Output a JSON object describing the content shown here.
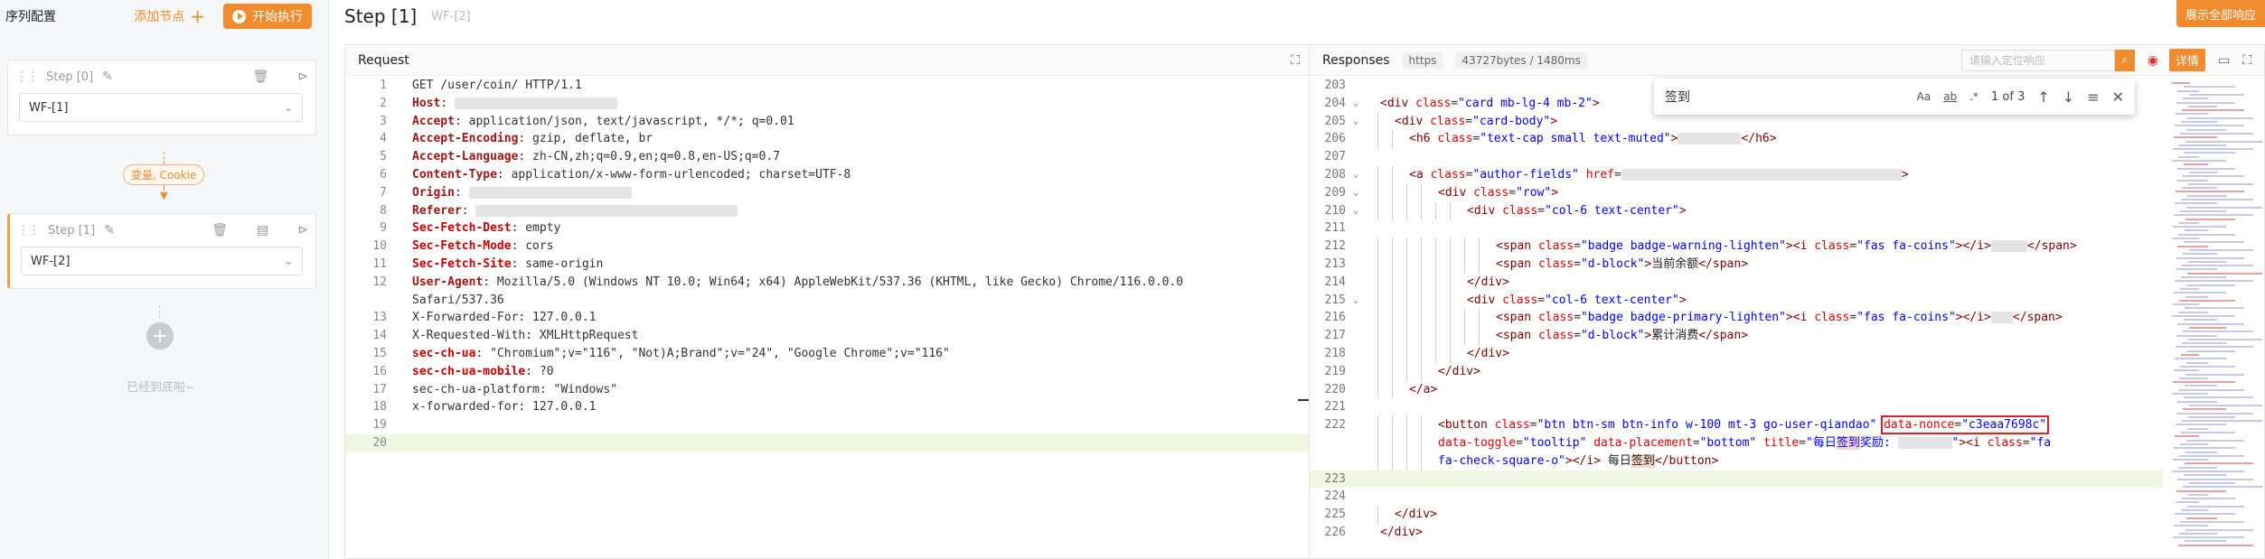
{
  "sidebar": {
    "title": "序列配置",
    "add_node": "添加节点",
    "start": "开始执行",
    "steps": [
      {
        "label": "Step [0]",
        "selected": "WF-[1]"
      },
      {
        "label": "Step [1]",
        "selected": "WF-[2]"
      }
    ],
    "var_pill": "变量, Cookie",
    "bottom_tip": "已经到底啦~"
  },
  "main": {
    "title": "Step [1]",
    "subtitle": "WF-[2]",
    "expand_all": "展示全部响应"
  },
  "request": {
    "title": "Request",
    "lines": [
      {
        "n": "1",
        "key": "",
        "text": "GET /user/coin/ HTTP/1.1",
        "style": "plain"
      },
      {
        "n": "2",
        "key": "Host",
        "text": ": ",
        "style": "key",
        "blur": "m"
      },
      {
        "n": "3",
        "key": "Accept",
        "text": ": application/json, text/javascript, */*; q=0.01",
        "style": "key"
      },
      {
        "n": "4",
        "key": "Accept-Encoding",
        "text": ": gzip, deflate, br",
        "style": "key"
      },
      {
        "n": "5",
        "key": "Accept-Language",
        "text": ": zh-CN,zh;q=0.9,en;q=0.8,en-US;q=0.7",
        "style": "key"
      },
      {
        "n": "6",
        "key": "Content-Type",
        "text": ": application/x-www-form-urlencoded; charset=UTF-8",
        "style": "key"
      },
      {
        "n": "7",
        "key": "Origin",
        "text": ": ",
        "style": "key",
        "blur": "m"
      },
      {
        "n": "8",
        "key": "Referer",
        "text": ": ",
        "style": "key",
        "blur": "l"
      },
      {
        "n": "9",
        "key": "Sec-Fetch-Dest",
        "text": ": empty",
        "style": "key2"
      },
      {
        "n": "10",
        "key": "Sec-Fetch-Mode",
        "text": ": cors",
        "style": "key2"
      },
      {
        "n": "11",
        "key": "Sec-Fetch-Site",
        "text": ": same-origin",
        "style": "key2"
      },
      {
        "n": "12",
        "key": "User-Agent",
        "text": ": Mozilla/5.0 (Windows NT 10.0; Win64; x64) AppleWebKit/537.36 (KHTML, like Gecko) Chrome/116.0.0.0",
        "style": "key"
      },
      {
        "n": "",
        "key": "",
        "text": "Safari/537.36",
        "style": "plain"
      },
      {
        "n": "13",
        "key": "",
        "text": "X-Forwarded-For: 127.0.0.1",
        "style": "plain"
      },
      {
        "n": "14",
        "key": "",
        "text": "X-Requested-With: XMLHttpRequest",
        "style": "plain"
      },
      {
        "n": "15",
        "key": "sec-ch-ua",
        "text": ": \"Chromium\";v=\"116\", \"Not)A;Brand\";v=\"24\", \"Google Chrome\";v=\"116\"",
        "style": "key2"
      },
      {
        "n": "16",
        "key": "sec-ch-ua-mobile",
        "text": ": ?0",
        "style": "key2"
      },
      {
        "n": "17",
        "key": "",
        "text": "sec-ch-ua-platform: \"Windows\"",
        "style": "plain"
      },
      {
        "n": "18",
        "key": "",
        "text": "x-forwarded-for: 127.0.0.1",
        "style": "plain"
      },
      {
        "n": "19",
        "key": "",
        "text": "",
        "style": "plain"
      },
      {
        "n": "20",
        "key": "",
        "text": "",
        "style": "plain",
        "hl": true
      }
    ]
  },
  "responses": {
    "title": "Responses",
    "protocol": "https",
    "size": "43727bytes / 1480ms",
    "search_placeholder": "请输入定位响应",
    "detail": "详情",
    "find": {
      "query": "签到",
      "count": "1 of 3",
      "opt_case": "Aa",
      "opt_word": "ab",
      "opt_regex": ".*"
    }
  },
  "html_lines": [
    {
      "n": "203",
      "indent": 0,
      "fold": false,
      "html": ""
    },
    {
      "n": "204",
      "indent": 0,
      "fold": true,
      "html": "<span class=\"tag\">&lt;div</span> <span class=\"attr\">class</span>=<span class=\"val\">\"card mb-lg-4 mb-2\"</span><span class=\"tag\">&gt;</span>"
    },
    {
      "n": "205",
      "indent": 1,
      "fold": true,
      "html": "<span class=\"tag\">&lt;div</span> <span class=\"attr\">class</span>=<span class=\"val\">\"card-body\"</span><span class=\"tag\">&gt;</span>"
    },
    {
      "n": "206",
      "indent": 2,
      "fold": false,
      "html": "<span class=\"tag\">&lt;h6</span> <span class=\"attr\">class</span>=<span class=\"val\">\"text-cap small text-muted\"</span><span class=\"tag\">&gt;</span><span class=\"blur\" style=\"width:70px\"></span><span class=\"tag\">&lt;/h6&gt;</span>"
    },
    {
      "n": "207",
      "indent": 0,
      "fold": false,
      "html": ""
    },
    {
      "n": "208",
      "indent": 2,
      "fold": true,
      "html": "<span class=\"tag\">&lt;a</span> <span class=\"attr\">class</span>=<span class=\"val\">\"author-fields\"</span> <span class=\"attr\">href</span>=<span class=\"blur xl\"></span><span class=\"tag\">&gt;</span>"
    },
    {
      "n": "209",
      "indent": 4,
      "fold": true,
      "html": "<span class=\"tag\">&lt;div</span> <span class=\"attr\">class</span>=<span class=\"val\">\"row\"</span><span class=\"tag\">&gt;</span>"
    },
    {
      "n": "210",
      "indent": 6,
      "fold": true,
      "html": "<span class=\"tag\">&lt;div</span> <span class=\"attr\">class</span>=<span class=\"val\">\"col-6 text-center\"</span><span class=\"tag\">&gt;</span>"
    },
    {
      "n": "211",
      "indent": 0,
      "fold": false,
      "html": ""
    },
    {
      "n": "212",
      "indent": 8,
      "fold": false,
      "html": "<span class=\"tag\">&lt;span</span> <span class=\"attr\">class</span>=<span class=\"val\">\"badge badge-warning-lighten\"</span><span class=\"tag\">&gt;&lt;i</span> <span class=\"attr\">class</span>=<span class=\"val\">\"fas fa-coins\"</span><span class=\"tag\">&gt;&lt;/i&gt;</span><span class=\"blur s\"></span><span class=\"tag\">&lt;/span&gt;</span>"
    },
    {
      "n": "213",
      "indent": 8,
      "fold": false,
      "html": "<span class=\"tag\">&lt;span</span> <span class=\"attr\">class</span>=<span class=\"val\">\"d-block\"</span><span class=\"tag\">&gt;</span><span class=\"txtc\">当前余额</span><span class=\"tag\">&lt;/span&gt;</span>"
    },
    {
      "n": "214",
      "indent": 6,
      "fold": false,
      "html": "<span class=\"tag\">&lt;/div&gt;</span>"
    },
    {
      "n": "215",
      "indent": 6,
      "fold": true,
      "html": "<span class=\"tag\">&lt;div</span> <span class=\"attr\">class</span>=<span class=\"val\">\"col-6 text-center\"</span><span class=\"tag\">&gt;</span>"
    },
    {
      "n": "216",
      "indent": 8,
      "fold": false,
      "html": "<span class=\"tag\">&lt;span</span> <span class=\"attr\">class</span>=<span class=\"val\">\"badge badge-primary-lighten\"</span><span class=\"tag\">&gt;&lt;i</span> <span class=\"attr\">class</span>=<span class=\"val\">\"fas fa-coins\"</span><span class=\"tag\">&gt;&lt;/i&gt;</span><span class=\"blur\" style=\"width:24px\"></span><span class=\"tag\">&lt;/span&gt;</span>"
    },
    {
      "n": "217",
      "indent": 8,
      "fold": false,
      "html": "<span class=\"tag\">&lt;span</span> <span class=\"attr\">class</span>=<span class=\"val\">\"d-block\"</span><span class=\"tag\">&gt;</span><span class=\"txtc\">累计消费</span><span class=\"tag\">&lt;/span&gt;</span>"
    },
    {
      "n": "218",
      "indent": 6,
      "fold": false,
      "html": "<span class=\"tag\">&lt;/div&gt;</span>"
    },
    {
      "n": "219",
      "indent": 4,
      "fold": false,
      "html": "<span class=\"tag\">&lt;/div&gt;</span>"
    },
    {
      "n": "220",
      "indent": 2,
      "fold": false,
      "html": "<span class=\"tag\">&lt;/a&gt;</span>"
    },
    {
      "n": "221",
      "indent": 0,
      "fold": false,
      "html": ""
    },
    {
      "n": "222",
      "indent": 4,
      "fold": false,
      "html": "<span class=\"tag\">&lt;button</span> <span class=\"attr\">class</span>=<span class=\"val\">\"btn btn-sm btn-info w-100 mt-3 go-user-qiandao\"</span> <span class=\"redbox\"><span class=\"attr\">data-nonce</span>=<span class=\"val\">\"c3eaa7698c\"</span></span>"
    },
    {
      "n": "",
      "indent": 4,
      "fold": false,
      "html": "<span class=\"attr\">data-toggle</span>=<span class=\"val\">\"tooltip\"</span> <span class=\"attr\">data-placement</span>=<span class=\"val\">\"bottom\"</span> <span class=\"attr\">title</span>=<span class=\"val\">\"每日<span class=\"found\">签到</span>奖励: </span><span class=\"blur\" style=\"width:60px\"></span><span class=\"val\">\"</span><span class=\"tag\">&gt;&lt;i</span> <span class=\"attr\">class</span>=<span class=\"val\">\"fa</span>"
    },
    {
      "n": "",
      "indent": 4,
      "fold": false,
      "html": "<span class=\"val\">fa-check-square-o\"</span><span class=\"tag\">&gt;&lt;/i&gt;</span> <span class=\"txtc\">每日<span class=\"found\">签到</span></span><span class=\"tag\">&lt;/button&gt;</span>"
    },
    {
      "n": "223",
      "indent": 0,
      "fold": false,
      "html": "",
      "hl": true
    },
    {
      "n": "224",
      "indent": 0,
      "fold": false,
      "html": ""
    },
    {
      "n": "225",
      "indent": 1,
      "fold": false,
      "html": "<span class=\"tag\">&lt;/div&gt;</span>"
    },
    {
      "n": "226",
      "indent": 0,
      "fold": false,
      "html": "<span class=\"tag\">&lt;/div&gt;</span>"
    }
  ]
}
